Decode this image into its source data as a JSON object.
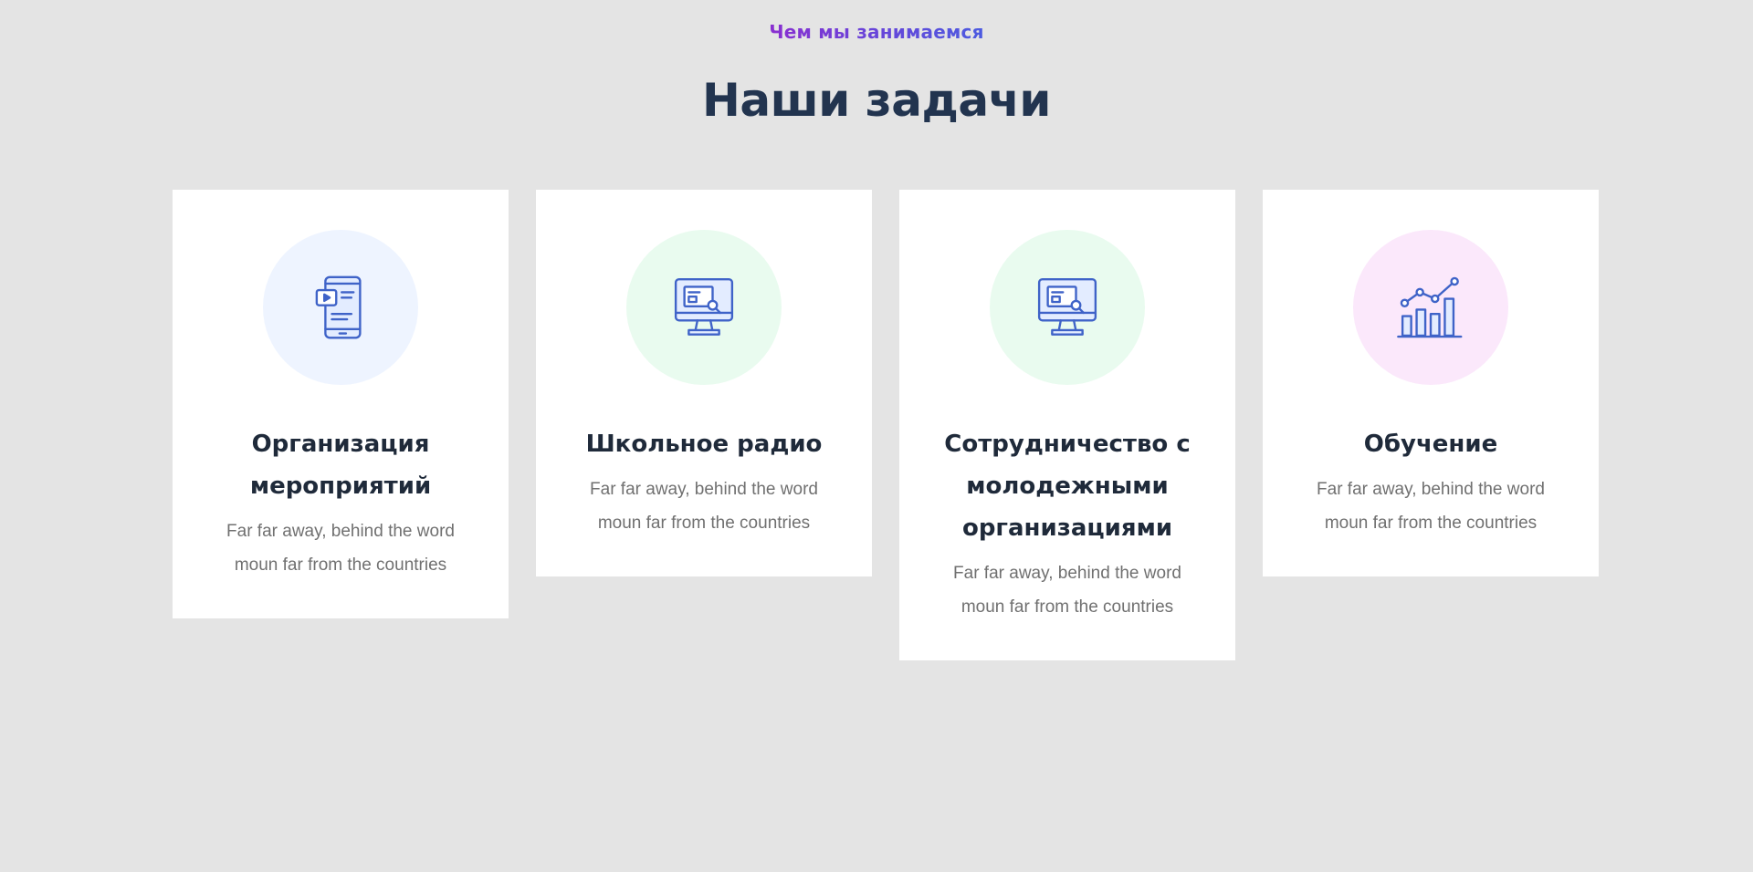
{
  "section": {
    "subheading": "Чем мы занимаемся",
    "heading": "Наши задачи"
  },
  "cards": [
    {
      "title": "Организация мероприятий",
      "text": "Far far away, behind the word moun far from the countries",
      "icon": "tablet-video-icon",
      "circle_color": "#eef4ff"
    },
    {
      "title": "Школьное радио",
      "text": "Far far away, behind the word moun far from the countries",
      "icon": "monitor-icon",
      "circle_color": "#e9fbef"
    },
    {
      "title": "Сотрудничество с молодежными организациями",
      "text": "Far far away, behind the word moun far from the countries",
      "icon": "monitor-icon",
      "circle_color": "#e9fbef"
    },
    {
      "title": "Обучение",
      "text": "Far far away, behind the word moun far from the countries",
      "icon": "bar-chart-growth-icon",
      "circle_color": "#fbe8fb"
    }
  ],
  "colors": {
    "background": "#e4e4e4",
    "card": "#ffffff",
    "heading": "#22344f",
    "subheading_start": "#8a2fd0",
    "subheading_end": "#4c5be0",
    "icon_stroke": "#3f63c8",
    "card_text": "#707070"
  }
}
